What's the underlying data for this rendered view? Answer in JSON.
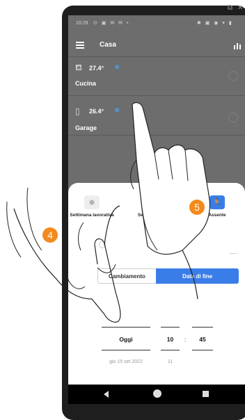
{
  "status_bar": {
    "time": "10:29"
  },
  "header": {
    "title": "Casa"
  },
  "rooms": [
    {
      "temperature": "27.4°",
      "name": "Cucina"
    },
    {
      "temperature": "26.4°",
      "name": "Garage"
    }
  ],
  "modes": [
    {
      "label": "Settimana lavorativa"
    },
    {
      "label": "Settimana di ferie"
    },
    {
      "label": "Assente"
    }
  ],
  "segmented": {
    "left": "Cambiamento",
    "right": "Data di fine"
  },
  "picker": {
    "date": "Oggi",
    "hour": "10",
    "separator": ":",
    "minute": "45",
    "next_date": "gio 15 set 2022",
    "next_hour": "11"
  },
  "badges": {
    "step_4": "4",
    "step_5": "5"
  },
  "colors": {
    "accent": "#3a7de8",
    "badge": "#f28a1e",
    "snow": "#49a8ff"
  }
}
